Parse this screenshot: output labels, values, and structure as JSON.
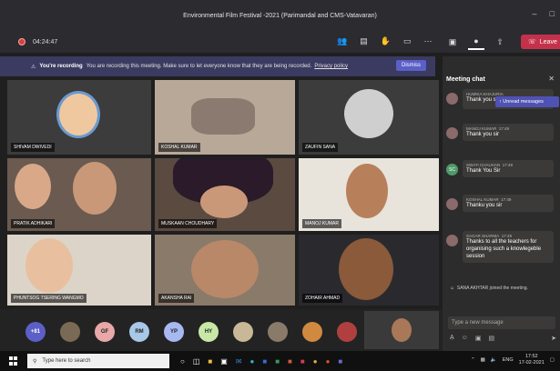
{
  "window": {
    "title": "Environmental Film Festival -2021 (Parimandal and CMS-Vatavaran)"
  },
  "toolbar": {
    "timer": "04:24:47",
    "leave_label": "Leave"
  },
  "banner": {
    "title": "You're recording",
    "message": "You are recording this meeting. Make sure to let everyone know that they are being recorded.",
    "link": "Privacy policy",
    "dismiss": "Dismiss"
  },
  "participants": [
    {
      "name": "SHIVAM DWIVEDI"
    },
    {
      "name": "KOSHAL KUMAR"
    },
    {
      "name": "ZAUFIN SANA"
    },
    {
      "name": "PRATIK ADHIKARI"
    },
    {
      "name": "MUSKAAN CHOUDHARY"
    },
    {
      "name": "MANOJ KUMAR"
    },
    {
      "name": "PHUNTSOG TSERING WANGMO"
    },
    {
      "name": "AKANSHA RAI"
    },
    {
      "name": "ZOHAIR AHMAD"
    }
  ],
  "avatars": [
    {
      "label": "+81",
      "color": "#5b5fc7"
    },
    {
      "label": "",
      "color": "#7a6a55"
    },
    {
      "label": "GF",
      "color": "#e8a8a8"
    },
    {
      "label": "RM",
      "color": "#a8c8e8"
    },
    {
      "label": "YP",
      "color": "#a8b8f0"
    },
    {
      "label": "HY",
      "color": "#c8e8a8"
    },
    {
      "label": "",
      "color": "#c8b898"
    },
    {
      "label": "",
      "color": "#8a7a6a"
    },
    {
      "label": "",
      "color": "#d08a40"
    },
    {
      "label": "",
      "color": "#b04040"
    }
  ],
  "chat": {
    "title": "Meeting chat",
    "unread_label": "Unread messages",
    "messages": [
      {
        "author": "HUMIKA KHAJURIA",
        "time": "",
        "text": "Thank you sir",
        "initials": ""
      },
      {
        "author": "MANOJ KUMAR",
        "time": "17:49",
        "text": "Thank you sir",
        "initials": ""
      },
      {
        "author": "SWATI CHAUHAN",
        "time": "17:49",
        "text": "Thank You Sir",
        "initials": "SC"
      },
      {
        "author": "KOSHAL KUMAR",
        "time": "17:49",
        "text": "Thanku you sir",
        "initials": ""
      },
      {
        "author": "SAGAR SHARMA",
        "time": "17:49",
        "text": "Thanks to all the teachers for organising such a knowlegeble session",
        "initials": ""
      }
    ],
    "system": {
      "name": "SANA AKHTAR",
      "text": "joined the meeting."
    },
    "compose_placeholder": "Type a new message"
  },
  "taskbar": {
    "search_placeholder": "Type here to search",
    "lang": "ENG",
    "time": "17:52",
    "date": "17-02-2021"
  }
}
